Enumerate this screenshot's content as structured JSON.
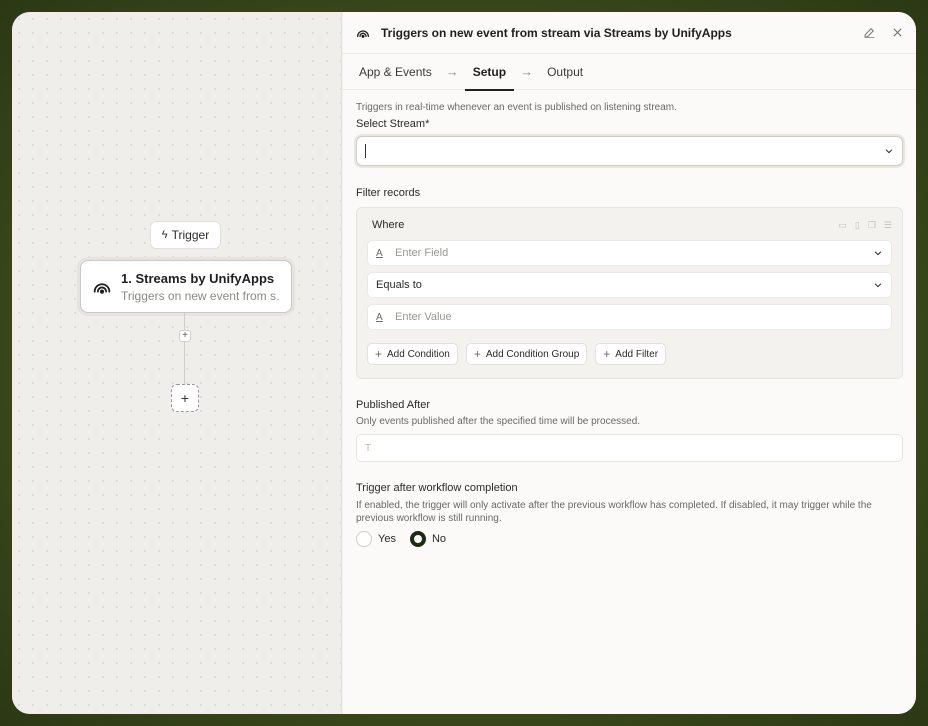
{
  "canvas": {
    "trigger_chip": "Trigger",
    "node": {
      "title": "1. Streams by UnifyApps",
      "subtitle": "Triggers on new event from stream via Streams by UnifyApps"
    },
    "add_step": "+",
    "add_node": "+"
  },
  "panel": {
    "title": "Triggers on new event from stream via",
    "title_suffix": "Streams by UnifyApps",
    "tabs": [
      {
        "label": "App & Events"
      },
      {
        "label": "Setup",
        "active": true
      },
      {
        "label": "Output"
      }
    ],
    "description": "Triggers in real-time whenever an event is published on listening stream.",
    "select_stream": {
      "label": "Select Stream*",
      "value": ""
    },
    "filter": {
      "label": "Filter records",
      "where": "Where",
      "field_placeholder": "Enter Field",
      "operator": "Equals to",
      "value_placeholder": "Enter Value",
      "buttons": {
        "add_condition": "Add Condition",
        "add_condition_group": "Add Condition Group",
        "add_filter": "Add Filter"
      }
    },
    "published_after": {
      "label": "Published After",
      "hint": "Only events published after the specified time will be processed.",
      "placeholder": "T"
    },
    "trigger_after": {
      "label": "Trigger after workflow completion",
      "hint": "If enabled, the trigger will only activate after the previous workflow has completed. If disabled, it may trigger while the previous workflow is still running.",
      "options": [
        {
          "label": "Yes",
          "selected": false
        },
        {
          "label": "No",
          "selected": true
        }
      ]
    }
  },
  "colors": {
    "accent": "#1f2a14",
    "background": "#3d4a1c"
  }
}
